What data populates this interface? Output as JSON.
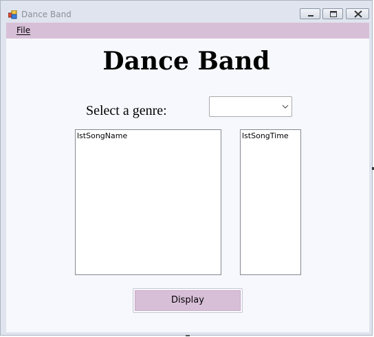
{
  "window": {
    "title": "Dance Band",
    "icon": "windows-form-icon",
    "controls": {
      "minimize_icon": "minimize-icon",
      "maximize_icon": "maximize-icon",
      "close_icon": "close-icon"
    }
  },
  "menubar": {
    "items": [
      {
        "label": "File"
      }
    ]
  },
  "main": {
    "heading": "Dance Band",
    "genre_label": "Select a genre:",
    "genre_select": {
      "value": "",
      "icon": "chevron-down-icon"
    },
    "song_name_list": {
      "items": [
        "lstSongName"
      ]
    },
    "song_time_list": {
      "items": [
        "lstSongTime"
      ]
    },
    "display_button": "Display"
  },
  "colors": {
    "menu_background": "#d8bfd8",
    "button_background": "#d8bfd8",
    "client_background": "#f7f8fd",
    "title_text": "#8a8f98"
  }
}
